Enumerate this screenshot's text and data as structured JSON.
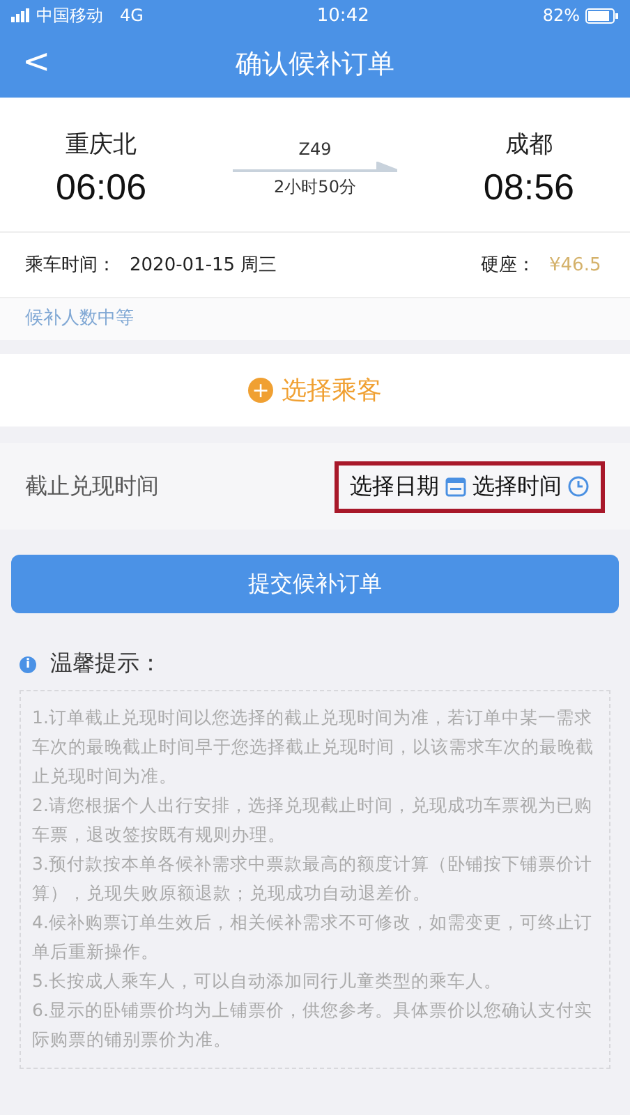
{
  "status_bar": {
    "carrier": "中国移动",
    "network": "4G",
    "time": "10:42",
    "battery": "82%"
  },
  "header": {
    "back": "<",
    "title": "确认候补订单"
  },
  "trip": {
    "from_station": "重庆北",
    "from_time": "06:06",
    "train": "Z49",
    "duration": "2小时50分",
    "to_station": "成都",
    "to_time": "08:56"
  },
  "ride": {
    "label": "乘车时间：",
    "date": "2020-01-15 周三",
    "seat": "硬座：",
    "price": "¥46.5"
  },
  "queue_note": "候补人数中等",
  "passenger_button": {
    "icon": "+",
    "label": "选择乘客"
  },
  "deadline": {
    "label": "截止兑现时间",
    "date_button": "选择日期",
    "time_button": "选择时间",
    "highlighted": true
  },
  "submit_button": "提交候补订单",
  "tips": {
    "icon": "i",
    "title": "温馨提示：",
    "items": [
      "1.订单截止兑现时间以您选择的截止兑现时间为准，若订单中某一需求车次的最晚截止时间早于您选择截止兑现时间，以该需求车次的最晚截止兑现时间为准。",
      "2.请您根据个人出行安排，选择兑现截止时间，兑现成功车票视为已购车票，退改签按既有规则办理。",
      "3.预付款按本单各候补需求中票款最高的额度计算（卧铺按下铺票价计算），兑现失败原额退款；兑现成功自动退差价。",
      "4.候补购票订单生效后，相关候补需求不可修改，如需变更，可终止订单后重新操作。",
      "5.长按成人乘车人，可以自动添加同行儿童类型的乘车人。",
      "6.显示的卧铺票价均为上铺票价，供您参考。具体票价以您确认支付实际购票的铺别票价为准。"
    ]
  }
}
